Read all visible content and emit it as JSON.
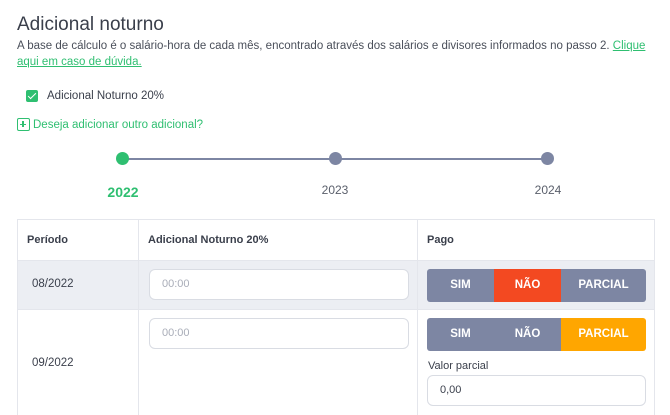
{
  "header": {
    "title": "Adicional noturno",
    "description": "A base de cálculo é o salário-hora de cada mês, encontrado através dos salários e divisores informados no passo 2.",
    "help_link": "Clique aqui em caso de dúvida."
  },
  "checkbox": {
    "label": "Adicional Noturno 20%",
    "checked": true
  },
  "add_link": "Deseja adicionar outro adicional?",
  "timeline": {
    "years": [
      "2022",
      "2023",
      "2024"
    ],
    "active": "2022"
  },
  "table": {
    "headers": {
      "periodo": "Período",
      "adicional": "Adicional Noturno 20%",
      "pago": "Pago"
    },
    "rows": [
      {
        "periodo": "08/2022",
        "input_placeholder": "00:00",
        "selected": "NÃO"
      },
      {
        "periodo": "09/2022",
        "input_placeholder": "00:00",
        "selected": "PARCIAL",
        "partial_label": "Valor parcial",
        "partial_value": "0,00"
      }
    ],
    "options": {
      "sim": "SIM",
      "nao": "NÃO",
      "parcial": "PARCIAL"
    }
  },
  "colors": {
    "accent": "#2fbf71",
    "button_default": "#7d86a3",
    "button_no": "#f34921",
    "button_partial": "#ffa600"
  }
}
